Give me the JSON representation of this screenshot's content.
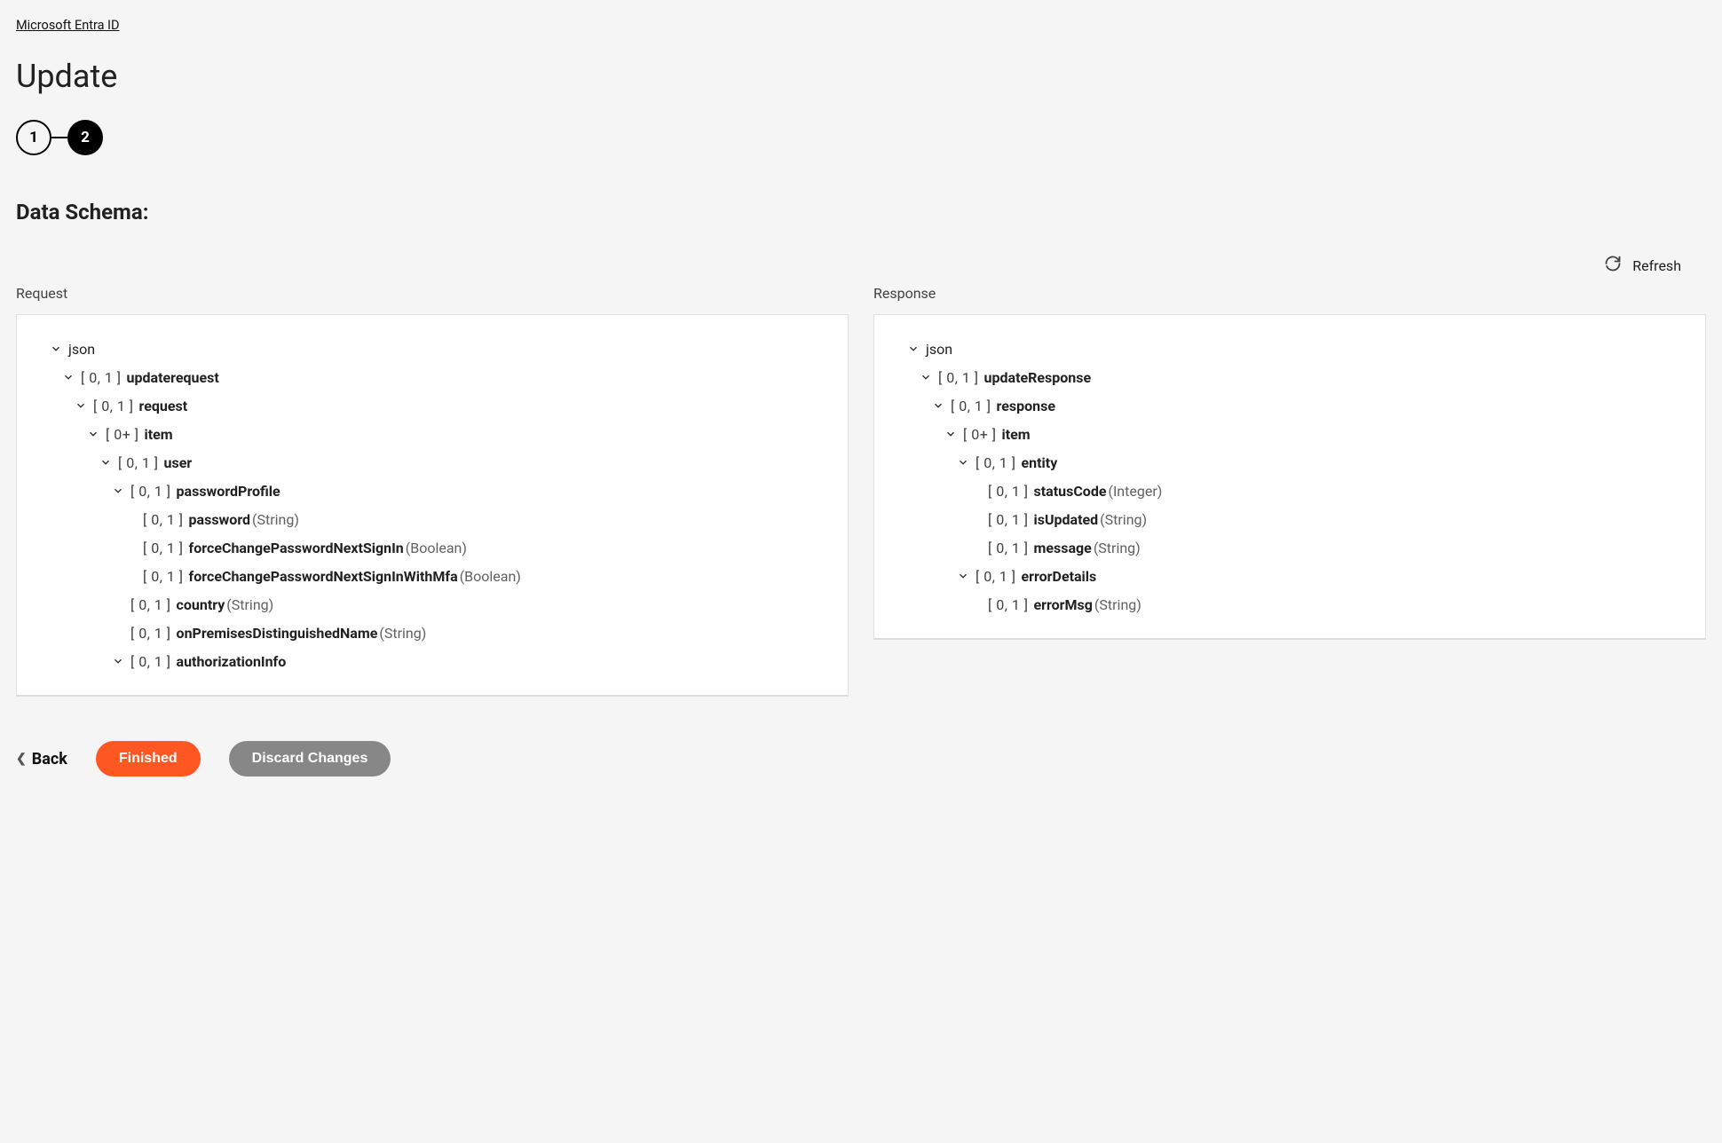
{
  "breadcrumb": {
    "link": "Microsoft Entra ID"
  },
  "page": {
    "title": "Update"
  },
  "stepper": {
    "step1": "1",
    "step2": "2"
  },
  "section": {
    "heading": "Data Schema:"
  },
  "actions": {
    "refresh": "Refresh",
    "back": "Back",
    "finished": "Finished",
    "discard": "Discard Changes"
  },
  "panels": {
    "request_label": "Request",
    "response_label": "Response"
  },
  "request_tree": {
    "root": "json",
    "n1": {
      "card": "[ 0, 1 ]",
      "name": "updaterequest"
    },
    "n2": {
      "card": "[ 0, 1 ]",
      "name": "request"
    },
    "n3": {
      "card": "[ 0+ ]",
      "name": "item"
    },
    "n4": {
      "card": "[ 0, 1 ]",
      "name": "user"
    },
    "n5": {
      "card": "[ 0, 1 ]",
      "name": "passwordProfile"
    },
    "n6": {
      "card": "[ 0, 1 ]",
      "name": "password",
      "type": "(String)"
    },
    "n7": {
      "card": "[ 0, 1 ]",
      "name": "forceChangePasswordNextSignIn",
      "type": "(Boolean)"
    },
    "n8": {
      "card": "[ 0, 1 ]",
      "name": "forceChangePasswordNextSignInWithMfa",
      "type": "(Boolean)"
    },
    "n9": {
      "card": "[ 0, 1 ]",
      "name": "country",
      "type": "(String)"
    },
    "n10": {
      "card": "[ 0, 1 ]",
      "name": "onPremisesDistinguishedName",
      "type": "(String)"
    },
    "n11": {
      "card": "[ 0, 1 ]",
      "name": "authorizationInfo"
    }
  },
  "response_tree": {
    "root": "json",
    "n1": {
      "card": "[ 0, 1 ]",
      "name": "updateResponse"
    },
    "n2": {
      "card": "[ 0, 1 ]",
      "name": "response"
    },
    "n3": {
      "card": "[ 0+ ]",
      "name": "item"
    },
    "n4": {
      "card": "[ 0, 1 ]",
      "name": "entity"
    },
    "n5": {
      "card": "[ 0, 1 ]",
      "name": "statusCode",
      "type": "(Integer)"
    },
    "n6": {
      "card": "[ 0, 1 ]",
      "name": "isUpdated",
      "type": "(String)"
    },
    "n7": {
      "card": "[ 0, 1 ]",
      "name": "message",
      "type": "(String)"
    },
    "n8": {
      "card": "[ 0, 1 ]",
      "name": "errorDetails"
    },
    "n9": {
      "card": "[ 0, 1 ]",
      "name": "errorMsg",
      "type": "(String)"
    }
  }
}
